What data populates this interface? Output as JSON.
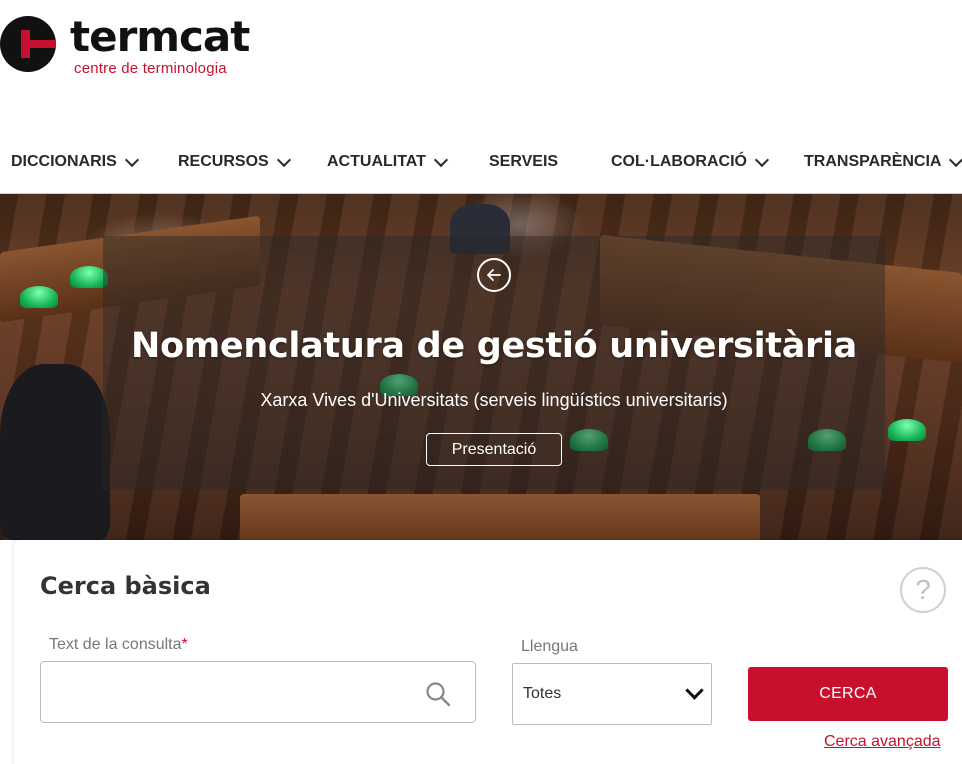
{
  "brand": {
    "name": "termcat",
    "tagline": "centre de terminologia",
    "accent_color": "#c8102e"
  },
  "nav": {
    "items": [
      {
        "label": "DICCIONARIS",
        "has_dropdown": true
      },
      {
        "label": "RECURSOS",
        "has_dropdown": true
      },
      {
        "label": "ACTUALITAT",
        "has_dropdown": true
      },
      {
        "label": "SERVEIS",
        "has_dropdown": false
      },
      {
        "label": "COL·LABORACIÓ",
        "has_dropdown": true
      },
      {
        "label": "TRANSPARÈNCIA",
        "has_dropdown": true
      }
    ]
  },
  "hero": {
    "prev_icon": "arrow-left-circle-icon",
    "title": "Nomenclatura de gestió universitària",
    "subtitle": "Xarxa Vives d'Universitats (serveis lingüístics universitaris)",
    "button_label": "Presentació"
  },
  "search": {
    "title": "Cerca bàsica",
    "help_glyph": "?",
    "query_label": "Text de la consulta",
    "query_required_mark": "*",
    "query_value": "",
    "language_label": "Llengua",
    "language_value": "Totes",
    "submit_label": "CERCA",
    "advanced_link": "Cerca avançada"
  }
}
